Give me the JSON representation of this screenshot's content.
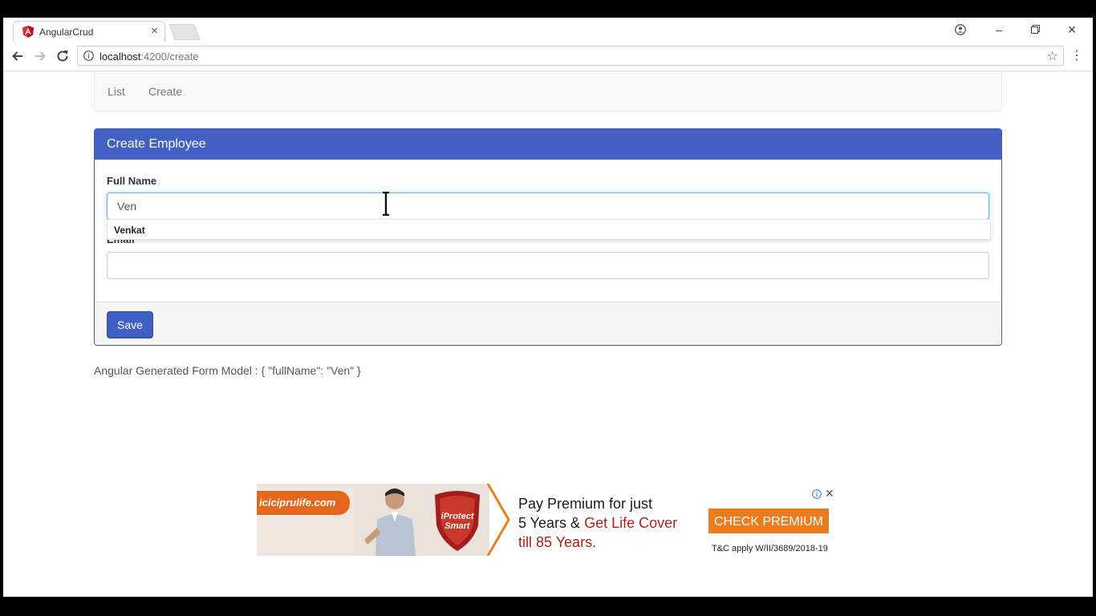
{
  "browser": {
    "tab_title": "AngularCrud",
    "url_host": "localhost",
    "url_path": ":4200/create"
  },
  "nav": {
    "items": [
      {
        "label": "List"
      },
      {
        "label": "Create"
      }
    ]
  },
  "panel": {
    "title": "Create Employee",
    "full_name_label": "Full Name",
    "full_name_value": "Ven",
    "autocomplete_suggestion": "Venkat",
    "email_label": "Email",
    "email_value": "",
    "save_label": "Save"
  },
  "form_model_text": "Angular Generated Form Model : { \"fullName\": \"Ven\" }",
  "ad": {
    "brand": "iciciprulife.com",
    "product_badge": "iProtect Smart",
    "line1": "Pay Premium for just",
    "line2_a": "5 Years & ",
    "line2_b": "Get Life Cover",
    "line3": "till 85 Years.",
    "cta": "CHECK PREMIUM",
    "tc": "T&C apply W/II/3689/2018-19"
  },
  "colors": {
    "panel_heading": "#4361c2",
    "primary_button": "#3f5fc4",
    "ad_orange": "#ec7c1e",
    "angular_red": "#dd2c2c"
  }
}
